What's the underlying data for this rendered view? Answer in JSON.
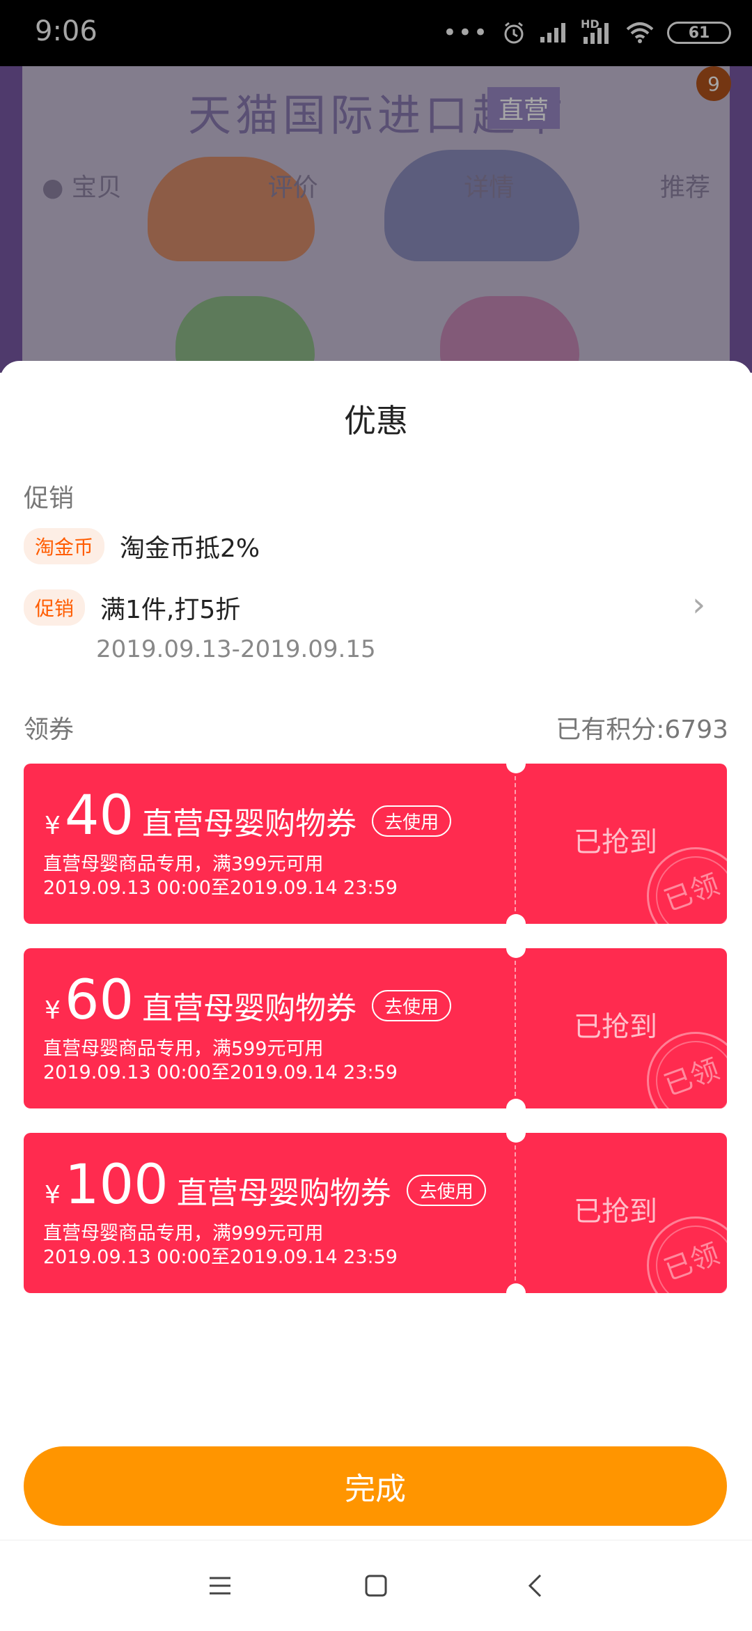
{
  "status_bar": {
    "time": "9:06",
    "battery": "61",
    "network_label": "HD"
  },
  "background_page": {
    "banner_text": "天猫国际进口超市",
    "banner_tag": "直营",
    "cart_count": "9",
    "tabs": [
      "宝贝",
      "评价",
      "详情",
      "推荐"
    ]
  },
  "sheet": {
    "title": "优惠",
    "promo_section_label": "促销",
    "promotions": [
      {
        "tag": "淘金币",
        "text": "淘金币抵2%"
      },
      {
        "tag": "促销",
        "text": "满1件,打5折",
        "sub": "2019.09.13-2019.09.15"
      }
    ],
    "coupon_section_label": "领券",
    "points_label": "已有积分:6793",
    "coupons": [
      {
        "currency": "¥",
        "amount": "40",
        "name": "直营母婴购物券",
        "use_label": "去使用",
        "condition": "直营母婴商品专用，满399元可用",
        "validity": "2019.09.13 00:00至2019.09.14 23:59",
        "status": "已抢到",
        "stamp": "已领"
      },
      {
        "currency": "¥",
        "amount": "60",
        "name": "直营母婴购物券",
        "use_label": "去使用",
        "condition": "直营母婴商品专用，满599元可用",
        "validity": "2019.09.13 00:00至2019.09.14 23:59",
        "status": "已抢到",
        "stamp": "已领"
      },
      {
        "currency": "¥",
        "amount": "100",
        "name": "直营母婴购物券",
        "use_label": "去使用",
        "condition": "直营母婴商品专用，满999元可用",
        "validity": "2019.09.13 00:00至2019.09.14 23:59",
        "status": "已抢到",
        "stamp": "已领"
      }
    ],
    "done_label": "完成"
  },
  "nav_bar": {
    "icons": [
      "menu-icon",
      "home-icon",
      "back-icon"
    ]
  },
  "colors": {
    "coupon_red": "#ff2b4f",
    "done_orange": "#ff9500",
    "tag_orange": "#ff5c00"
  }
}
